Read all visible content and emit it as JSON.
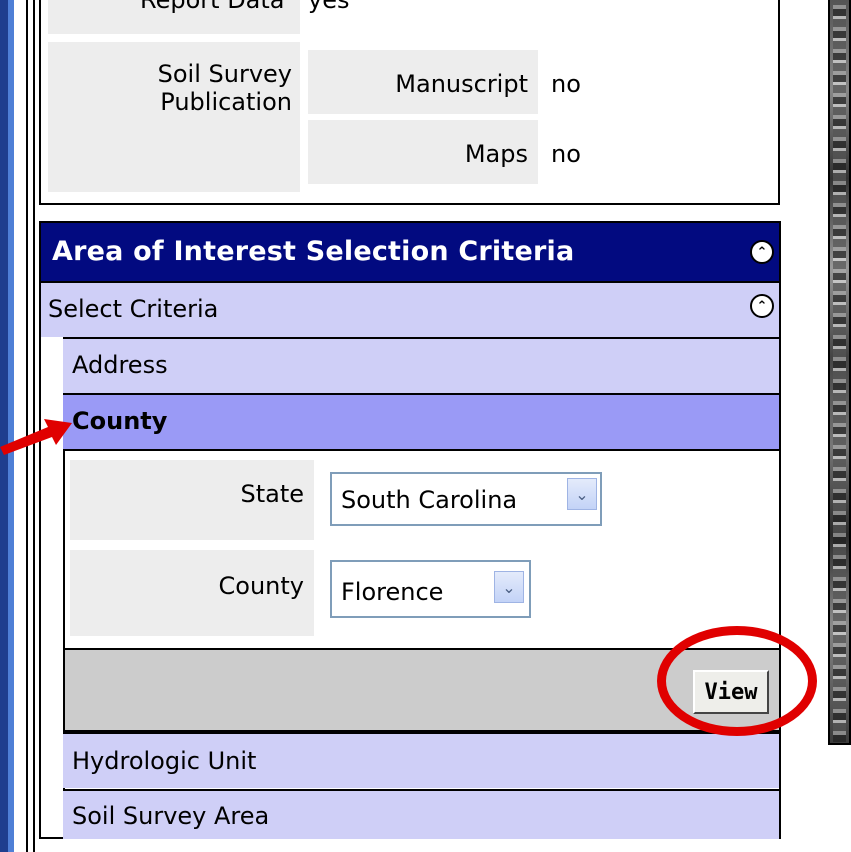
{
  "report": {
    "report_data_label": "Report Data",
    "report_data_value": "yes",
    "soil_survey_label": "Soil Survey\nPublication",
    "manuscript_label": "Manuscript",
    "manuscript_value": "no",
    "maps_label": "Maps",
    "maps_value": "no"
  },
  "aoi": {
    "title": "Area of Interest Selection Criteria",
    "select_criteria": "Select Criteria",
    "options": {
      "address": "Address",
      "county": "County",
      "hydrologic_unit": "Hydrologic Unit",
      "soil_survey_area": "Soil Survey Area"
    },
    "state_label": "State",
    "state_value": "South Carolina",
    "county_label": "County",
    "county_value": "Florence",
    "view_label": "View"
  },
  "icons": {
    "collapse": "chevron-double-up-icon",
    "dropdown": "chevron-down-icon",
    "pointer": "red-arrow-icon"
  },
  "colors": {
    "header_bg": "#020a80",
    "option_bg": "#cfcff7",
    "selected_bg": "#9a9af6",
    "annotation_red": "#e00000"
  }
}
